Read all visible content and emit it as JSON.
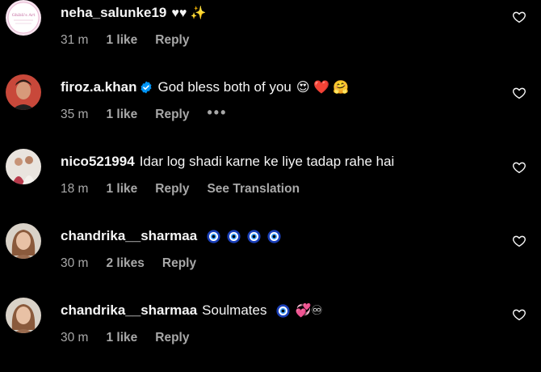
{
  "comments": [
    {
      "username": "neha_salunke19",
      "text": "",
      "emoji": "♥♥ ✨",
      "time": "31 m",
      "likes": "1 like",
      "reply": "Reply",
      "avatar_text": "Ghibli's Art"
    },
    {
      "username": "firoz.a.khan",
      "text": "God bless both of you",
      "emoji": "😍 ❤️ 🤗",
      "time": "35 m",
      "likes": "1 like",
      "reply": "Reply",
      "more": "•••",
      "verified": true
    },
    {
      "username": "nico521994",
      "text": "Idar log shadi karne ke liye tadap rahe hai",
      "time": "18 m",
      "likes": "1 like",
      "reply": "Reply",
      "translation": "See Translation"
    },
    {
      "username": "chandrika__sharmaa",
      "text": "",
      "emoji_count": 4,
      "time": "30 m",
      "likes": "2 likes",
      "reply": "Reply"
    },
    {
      "username": "chandrika__sharmaa",
      "text": "Soulmates",
      "emoji_tail": "💞♾",
      "time": "30 m",
      "likes": "1 like",
      "reply": "Reply"
    }
  ],
  "colors": {
    "background": "#000000",
    "text": "#f5f5f5",
    "meta": "#a8a8a8",
    "verified": "#0095f6"
  },
  "icons": {
    "like": "heart-outline-icon",
    "verified": "verified-badge-icon",
    "evil_eye": "nazar-amulet-icon"
  }
}
